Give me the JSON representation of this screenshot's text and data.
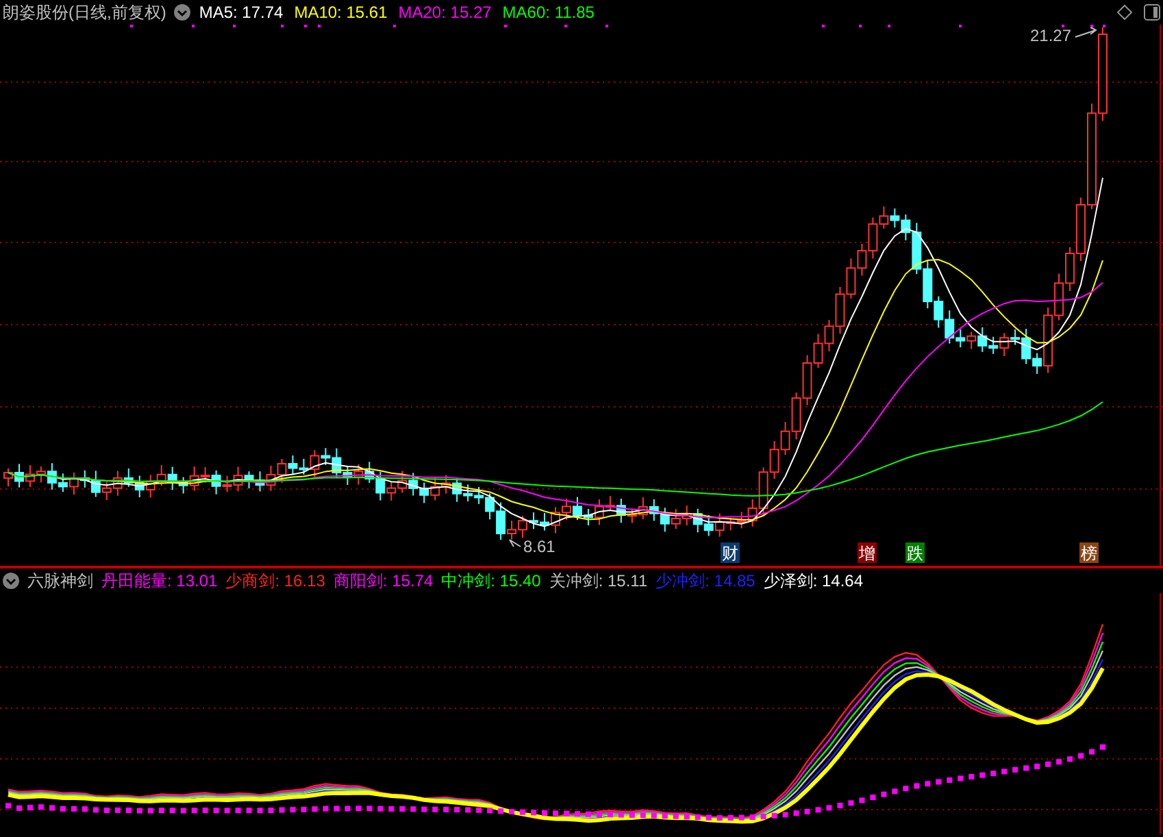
{
  "title": "朗姿股份(日线,前复权)",
  "ma_legend": [
    {
      "label": "MA5: 17.74",
      "color": "#ffffff"
    },
    {
      "label": "MA10: 15.61",
      "color": "#ffff00"
    },
    {
      "label": "MA20: 15.27",
      "color": "#ff00ff"
    },
    {
      "label": "MA60: 11.85",
      "color": "#00ff00"
    }
  ],
  "price_labels": [
    {
      "kind": "high",
      "text": "21.27"
    },
    {
      "kind": "low",
      "text": "8.61"
    }
  ],
  "event_markers": [
    {
      "text": "财",
      "color": "#0a3c6e"
    },
    {
      "text": "增",
      "color": "#8b0000"
    },
    {
      "text": "跌",
      "color": "#008000"
    },
    {
      "text": "榜",
      "color": "#8b4513"
    }
  ],
  "indicator": {
    "title": "六脉神剑",
    "legend": [
      {
        "label": "丹田能量: 13.01",
        "color": "#ff00ff"
      },
      {
        "label": "少商剑: 16.13",
        "color": "#ff2020"
      },
      {
        "label": "商阳剑: 15.74",
        "color": "#ff00ff"
      },
      {
        "label": "中冲剑: 15.40",
        "color": "#00ff00"
      },
      {
        "label": "关冲剑: 15.11",
        "color": "#c0c0c0"
      },
      {
        "label": "少冲剑: 14.85",
        "color": "#2020ff"
      },
      {
        "label": "少泽剑: 14.64",
        "color": "#ffffff"
      }
    ]
  }
}
